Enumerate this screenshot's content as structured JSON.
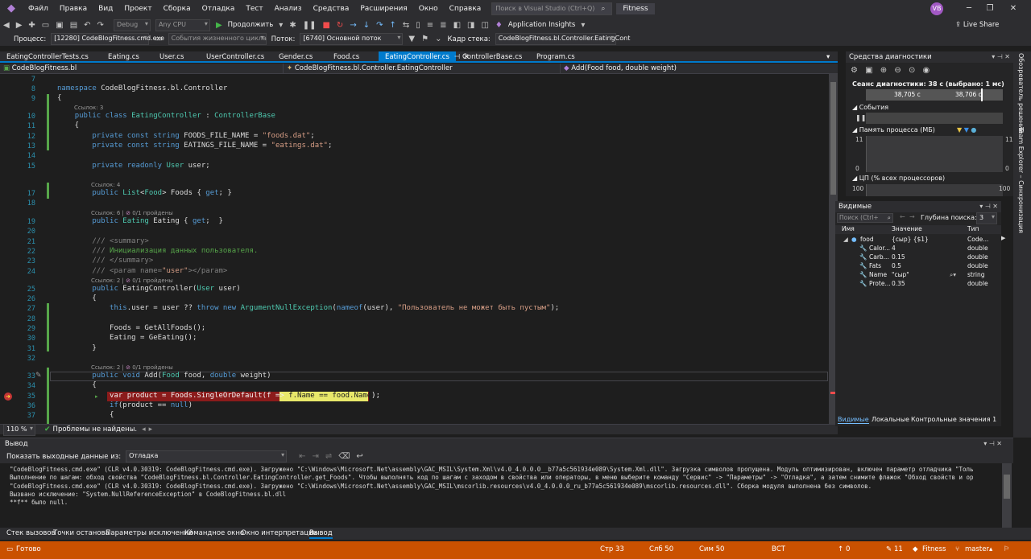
{
  "title_bar": {
    "menu": [
      "Файл",
      "Правка",
      "Вид",
      "Проект",
      "Сборка",
      "Отладка",
      "Тест",
      "Анализ",
      "Средства",
      "Расширения",
      "Окно",
      "Справка"
    ],
    "search_placeholder": "Поиск в Visual Studio (Ctrl+Q)",
    "solution_name": "Fitness",
    "avatar_initials": "VB",
    "live_share": "Live Share"
  },
  "toolbar1": {
    "config": "Debug",
    "platform": "Any CPU",
    "continue_label": "Продолжить",
    "app_insights": "Application Insights"
  },
  "toolbar2": {
    "process_label": "Процесс:",
    "process_value": "[12280] CodeBlogFitness.cmd.exe",
    "lifecycle_label": "События жизненного цикла",
    "thread_label": "Поток:",
    "thread_value": "[6740] Основной поток",
    "stackframe_label": "Кадр стека:",
    "stackframe_value": "CodeBlogFitness.bl.Controller.EatingCont"
  },
  "tabs": [
    "EatingControllerTests.cs",
    "Eating.cs",
    "User.cs",
    "UserController.cs",
    "Gender.cs",
    "Food.cs",
    "EatingController.cs",
    "ControllerBase.cs",
    "Program.cs"
  ],
  "active_tab": "EatingController.cs",
  "navbar": {
    "project": "CodeBlogFitness.bl",
    "class": "CodeBlogFitness.bl.Controller.EatingController",
    "member": "Add(Food food, double weight)"
  },
  "lens": {
    "refs3": "Ссылок: 3",
    "refs4": "Ссылок: 4",
    "refs6": "Ссылок: 6",
    "refs2": "Ссылок: 2",
    "passed": "0/1 пройдены"
  },
  "line_numbers": [
    "7",
    "8",
    "9",
    "10",
    "11",
    "12",
    "13",
    "14",
    "15",
    "17",
    "18",
    "19",
    "20",
    "21",
    "22",
    "23",
    "24",
    "25",
    "26",
    "27",
    "28",
    "29",
    "30",
    "31",
    "32",
    "33",
    "34",
    "35",
    "36",
    "37"
  ],
  "editor_status": {
    "zoom": "110 %",
    "problems": "Проблемы не найдены."
  },
  "diag": {
    "title": "Средства диагностики",
    "session": "Сеанс диагностики: 38 с (выбрано: 1 мс)",
    "time_left": "38,705 с",
    "time_right": "38,706 с",
    "events": "События",
    "memory": "Память процесса (МБ)",
    "mem_top": "11",
    "mem_bottom": "0",
    "cpu": "ЦП (% всех процессоров)",
    "cpu_top": "100"
  },
  "locals": {
    "title": "Видимые",
    "search_placeholder": "Поиск (Ctrl+",
    "depth_label": "Глубина поиска:",
    "depth_value": "3",
    "col_name": "Имя",
    "col_value": "Значение",
    "col_type": "Тип",
    "rows": [
      {
        "name": "food",
        "value": "{сыр} {$1}",
        "type": "Code..."
      },
      {
        "name": "Calor...",
        "value": "4",
        "type": "double"
      },
      {
        "name": "Carb...",
        "value": "0.15",
        "type": "double"
      },
      {
        "name": "Fats",
        "value": "0.5",
        "type": "double"
      },
      {
        "name": "Name",
        "value": "\"сыр\"",
        "type": "string"
      },
      {
        "name": "Prote...",
        "value": "0.35",
        "type": "double"
      }
    ],
    "tabs": [
      "Видимые",
      "Локальные",
      "Контрольные значения 1"
    ]
  },
  "vstrip": [
    "Обозреватель решений",
    "Team Explorer – Синхронизация"
  ],
  "output": {
    "title": "Вывод",
    "show_label": "Показать выходные данные из:",
    "source": "Отладка",
    "lines": [
      "\"CodeBlogFitness.cmd.exe\" (CLR v4.0.30319: CodeBlogFitness.cmd.exe). Загружено \"C:\\Windows\\Microsoft.Net\\assembly\\GAC_MSIL\\System.Xml\\v4.0_4.0.0.0__b77a5c561934e089\\System.Xml.dll\". Загрузка символов пропущена. Модуль оптимизирован, включен параметр отладчика \"Толь",
      "Выполнение по шагам: обход свойства \"CodeBlogFitness.bl.Controller.EatingController.get_Foods\". Чтобы выполнять код по шагам с заходом в свойства или операторы, в меню выберите команду \"Сервис\" -> \"Параметры\" -> \"Отладка\", а затем снимите флажок \"Обход свойств и ор",
      "\"CodeBlogFitness.cmd.exe\" (CLR v4.0.30319: CodeBlogFitness.cmd.exe). Загружено \"C:\\Windows\\Microsoft.Net\\assembly\\GAC_MSIL\\mscorlib.resources\\v4.0_4.0.0.0_ru_b77a5c561934e089\\mscorlib.resources.dll\". Сборка модуля выполнена без символов.",
      "Вызвано исключение: \"System.NullReferenceException\" в CodeBlogFitness.bl.dll",
      "**f** было null."
    ]
  },
  "bottom_tabs": [
    "Стек вызовов",
    "Точки останова",
    "Параметры исключений",
    "Командное окно",
    "Окно интерпретации",
    "Вывод"
  ],
  "status": {
    "ready": "Готово",
    "line": "Стр 33",
    "col": "Слб 50",
    "char": "Сим 50",
    "mode": "ВСТ",
    "up": "0",
    "pencil": "11",
    "repo": "Fitness",
    "branch": "master"
  }
}
